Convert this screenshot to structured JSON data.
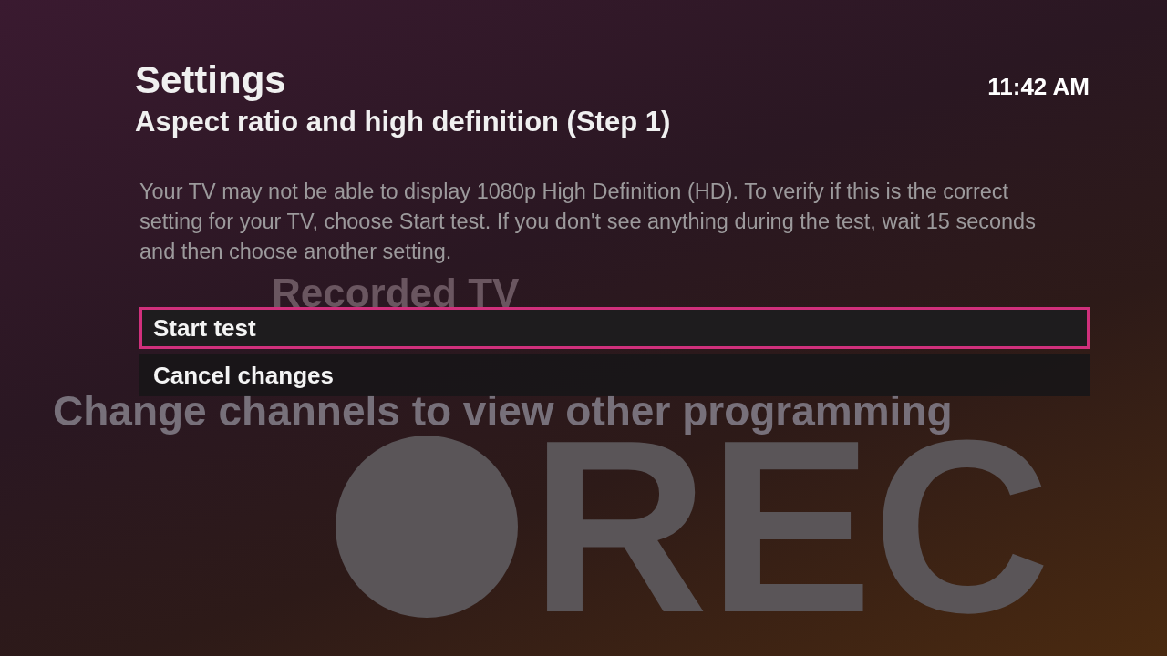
{
  "background": {
    "caption": "Recorded TV",
    "banner": "Change channels to view other programming",
    "recording_label": "REC"
  },
  "header": {
    "title": "Settings",
    "subtitle": "Aspect ratio and high definition (Step 1)",
    "clock": "11:42 AM"
  },
  "description": "Your TV may not be able to display 1080p High Definition (HD). To verify if this is the correct setting for your TV, choose Start test. If you don't see anything during the test, wait 15 seconds and then choose another setting.",
  "menu": [
    {
      "label": "Start test",
      "selected": true
    },
    {
      "label": "Cancel changes",
      "selected": false
    }
  ]
}
